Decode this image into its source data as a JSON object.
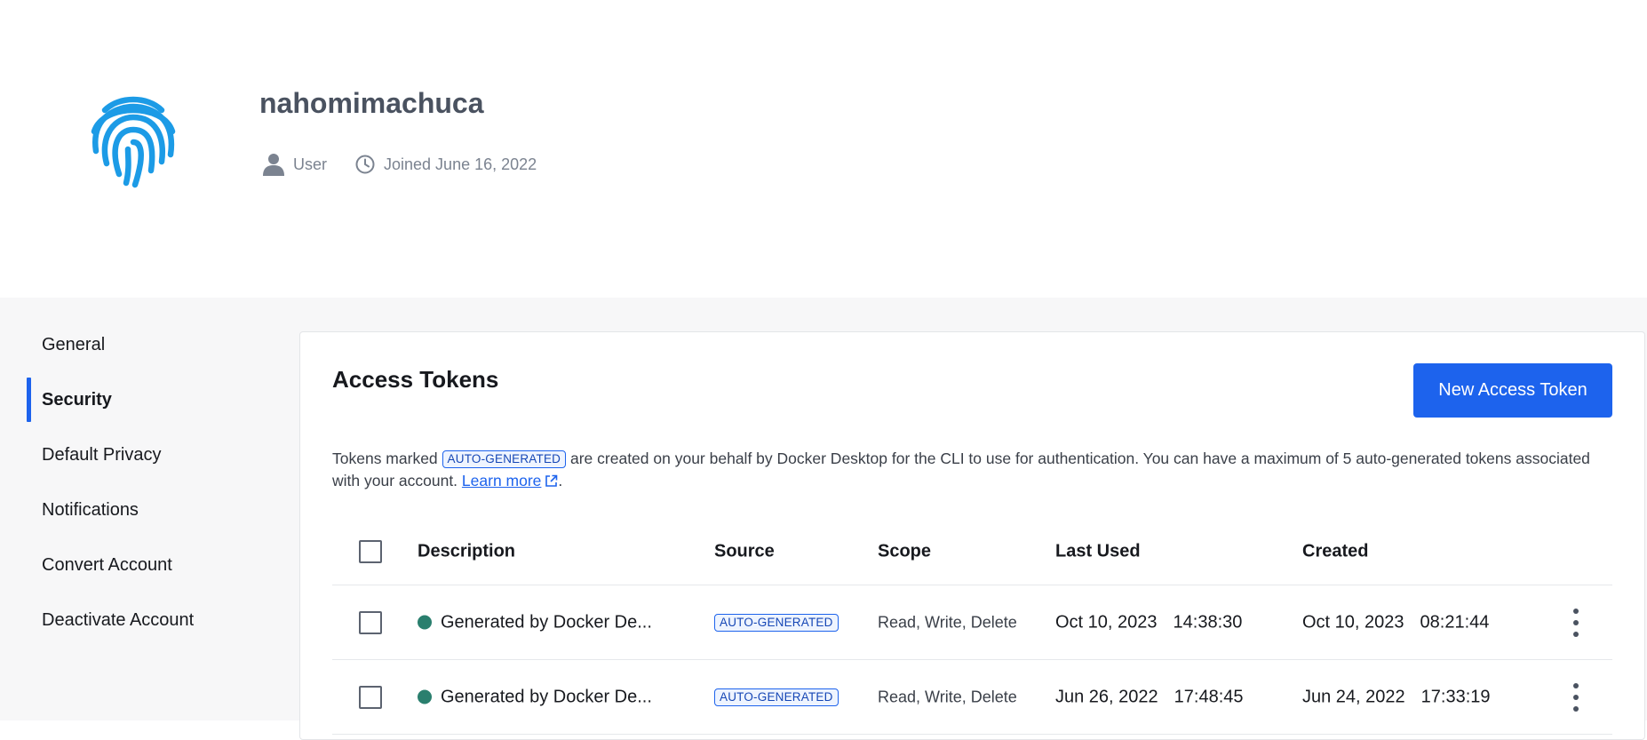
{
  "profile": {
    "username": "nahomimachuca",
    "role": "User",
    "joined": "Joined June 16, 2022"
  },
  "sidebar": {
    "items": [
      {
        "label": "General"
      },
      {
        "label": "Security",
        "active": true
      },
      {
        "label": "Default Privacy"
      },
      {
        "label": "Notifications"
      },
      {
        "label": "Convert Account"
      },
      {
        "label": "Deactivate Account"
      }
    ]
  },
  "tokens": {
    "title": "Access Tokens",
    "new_button": "New Access Token",
    "desc_prefix": "Tokens marked",
    "desc_badge": "AUTO-GENERATED",
    "desc_suffix": "are created on your behalf by Docker Desktop for the CLI to use for authentication. You can have a maximum of 5 auto-generated tokens associated with your account.",
    "learn_more": "Learn more",
    "desc_end": ".",
    "columns": {
      "description": "Description",
      "source": "Source",
      "scope": "Scope",
      "last_used": "Last Used",
      "created": "Created"
    },
    "rows": [
      {
        "description": "Generated by Docker De...",
        "source": "AUTO-GENERATED",
        "scope": "Read, Write, Delete",
        "last_used_date": "Oct 10, 2023",
        "last_used_time": "14:38:30",
        "created_date": "Oct 10, 2023",
        "created_time": "08:21:44"
      },
      {
        "description": "Generated by Docker De...",
        "source": "AUTO-GENERATED",
        "scope": "Read, Write, Delete",
        "last_used_date": "Jun 26, 2022",
        "last_used_time": "17:48:45",
        "created_date": "Jun 24, 2022",
        "created_time": "17:33:19"
      }
    ]
  },
  "colors": {
    "accent": "#1d63ed",
    "fingerprint": "#1c9be6",
    "status_active": "#2a7f6e"
  }
}
